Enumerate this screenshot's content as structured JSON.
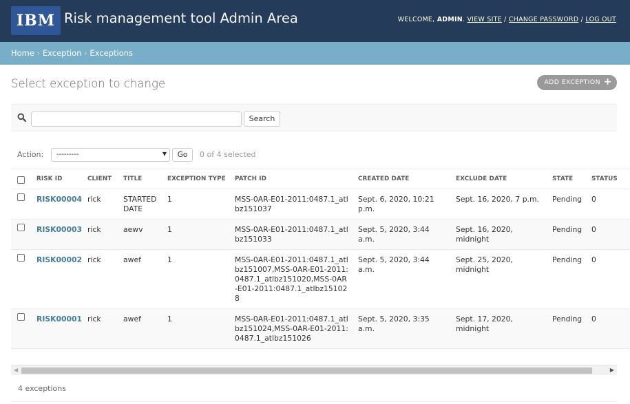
{
  "header": {
    "logo_text": "IBM",
    "title": "Risk management tool Admin Area",
    "welcome": "WELCOME,",
    "username": "ADMIN",
    "view_site": "VIEW SITE",
    "change_password": "CHANGE PASSWORD",
    "log_out": "LOG OUT",
    "separator": "/"
  },
  "breadcrumbs": {
    "home": "Home",
    "app": "Exception",
    "current": "Exceptions",
    "separator": "›"
  },
  "page_title": "Select exception to change",
  "add_button": {
    "label": "ADD EXCEPTION",
    "icon": "+"
  },
  "search": {
    "value": "",
    "placeholder": "",
    "button_label": "Search",
    "icon": "search-icon"
  },
  "actions": {
    "label": "Action:",
    "selected_option": "---------",
    "go_label": "Go",
    "selected_count": "0 of 4 selected"
  },
  "table": {
    "columns": [
      "RISK ID",
      "CLIENT",
      "TITLE",
      "EXCEPTION TYPE",
      "PATCH ID",
      "CREATED DATE",
      "EXCLUDE DATE",
      "STATE",
      "STATUS"
    ],
    "rows": [
      {
        "risk_id": "RISK00004",
        "client": "rick",
        "title": "STARTED DATE",
        "exception_type": "1",
        "patch_id": "MSS-0AR-E01-2011:0487.1_atlbz151037",
        "created_date": "Sept. 6, 2020, 10:21 p.m.",
        "exclude_date": "Sept. 16, 2020, 7 p.m.",
        "state": "Pending",
        "status": "0"
      },
      {
        "risk_id": "RISK00003",
        "client": "rick",
        "title": "aewv",
        "exception_type": "1",
        "patch_id": "MSS-0AR-E01-2011:0487.1_atlbz151033",
        "created_date": "Sept. 5, 2020, 3:44 a.m.",
        "exclude_date": "Sept. 16, 2020, midnight",
        "state": "Pending",
        "status": "0"
      },
      {
        "risk_id": "RISK00002",
        "client": "rick",
        "title": "awef",
        "exception_type": "1",
        "patch_id": "MSS-0AR-E01-2011:0487.1_atlbz151007,MSS-0AR-E01-2011:0487.1_atlbz151020,MSS-0AR-E01-2011:0487.1_atlbz151028",
        "created_date": "Sept. 5, 2020, 3:44 a.m.",
        "exclude_date": "Sept. 25, 2020, midnight",
        "state": "Pending",
        "status": "0"
      },
      {
        "risk_id": "RISK00001",
        "client": "rick",
        "title": "awef",
        "exception_type": "1",
        "patch_id": "MSS-0AR-E01-2011:0487.1_atlbz151024,MSS-0AR-E01-2011:0487.1_atlbz151026",
        "created_date": "Sept. 5, 2020, 3:35 a.m.",
        "exclude_date": "Sept. 17, 2020, midnight",
        "state": "Pending",
        "status": "0"
      }
    ]
  },
  "paginator": {
    "text": "4 exceptions"
  },
  "colors": {
    "header_bg": "#253b5a",
    "breadcrumb_bg": "#79aec8",
    "link": "#447e9b",
    "logo_bg": "#2f5696"
  }
}
